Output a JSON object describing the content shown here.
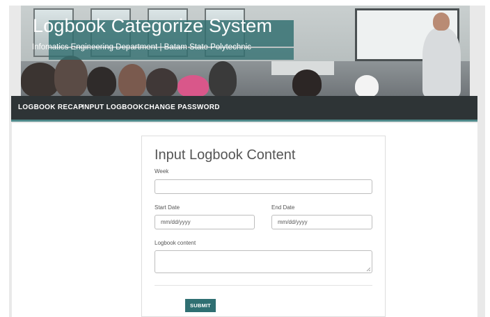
{
  "header": {
    "title": "Logbook Categorize System",
    "subtitle": "Infomatics Engineering Department | Batam State Polytechnic",
    "title_box_color": "#2f6e6f",
    "photo_icon": "classroom-photo"
  },
  "nav": {
    "items": [
      {
        "label": "LOGBOOK RECAP"
      },
      {
        "label": "INPUT LOGBOOK"
      },
      {
        "label": "CHANGE PASSWORD"
      }
    ],
    "background_color": "#2e3436",
    "accent_color": "#4f8a8b"
  },
  "form": {
    "title": "Input Logbook Content",
    "week": {
      "label": "Week",
      "value": ""
    },
    "start_date": {
      "label": "Start Date",
      "placeholder": "mm/dd/yyyy"
    },
    "end_date": {
      "label": "End Date",
      "placeholder": "mm/dd/yyyy"
    },
    "content": {
      "label": "Logbook content",
      "value": ""
    },
    "submit_label": "SUBMIT",
    "submit_color": "#2f6f72"
  }
}
